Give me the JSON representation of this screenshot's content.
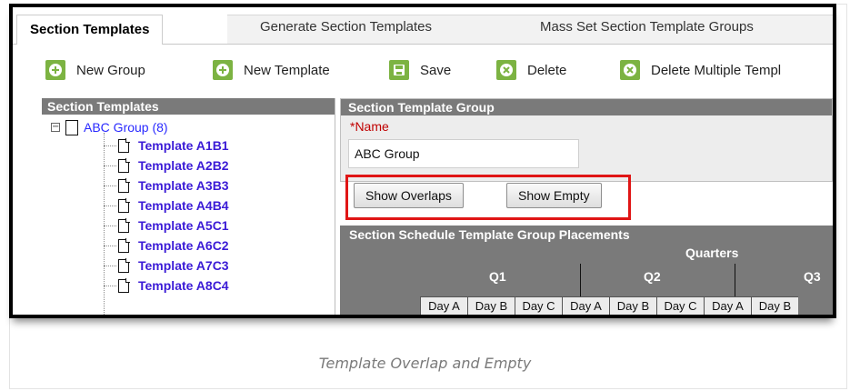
{
  "tabs": [
    {
      "label": "Section Templates",
      "active": true
    },
    {
      "label": "Generate Section Templates",
      "active": false
    },
    {
      "label": "Mass Set Section Template Groups",
      "active": false
    }
  ],
  "toolbar": {
    "new_group": "New Group",
    "new_template": "New Template",
    "save": "Save",
    "delete": "Delete",
    "delete_multiple": "Delete Multiple Templ",
    "accent_color": "#7cb342"
  },
  "tree": {
    "header": "Section Templates",
    "root": "ABC Group (8)",
    "items": [
      "Template A1B1",
      "Template A2B2",
      "Template A3B3",
      "Template A4B4",
      "Template A5C1",
      "Template A6C2",
      "Template A7C3",
      "Template A8C4"
    ]
  },
  "group": {
    "header": "Section Template Group",
    "name_label": "*Name",
    "name_value": "ABC Group"
  },
  "buttons": {
    "show_overlaps": "Show Overlaps",
    "show_empty": "Show Empty",
    "highlight_color": "#e01515"
  },
  "placements": {
    "title": "Section Schedule Template Group Placements",
    "quarters_label": "Quarters",
    "quarters": [
      "Q1",
      "Q2",
      "Q3"
    ],
    "days": [
      "Day A",
      "Day B",
      "Day C",
      "Day A",
      "Day B",
      "Day C",
      "Day A",
      "Day B"
    ]
  },
  "caption": "Template Overlap and Empty"
}
